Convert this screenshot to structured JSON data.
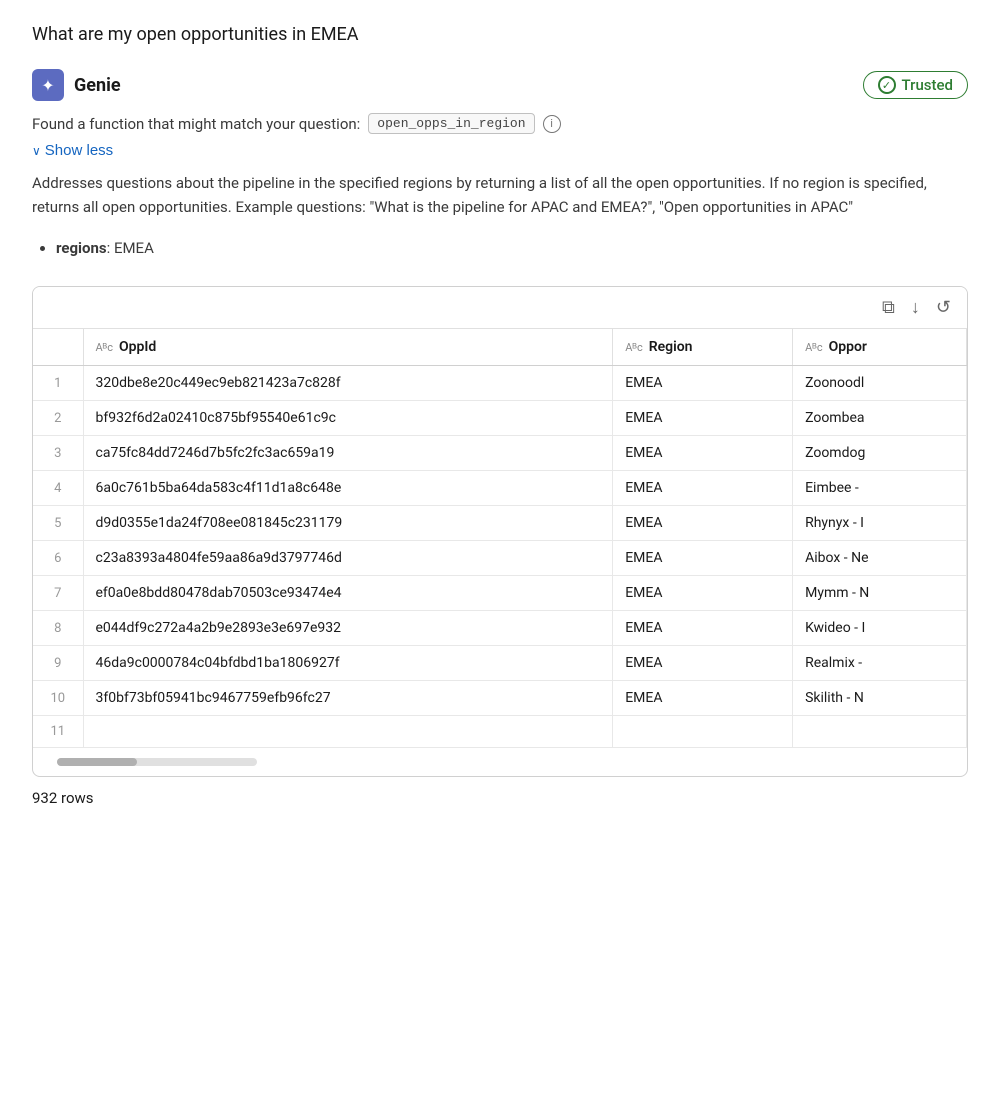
{
  "query": {
    "text": "What are my open opportunities in EMEA"
  },
  "genie": {
    "name": "Genie",
    "icon_symbol": "✦",
    "trusted_label": "Trusted",
    "found_function_text": "Found a function that might match your question:",
    "function_name": "open_opps_in_region",
    "show_less_label": "Show less",
    "description": "Addresses questions about the pipeline in the specified regions by returning a list of all the open opportunities. If no region is specified, returns all open opportunities. Example questions: \"What is the pipeline for APAC and EMEA?\", \"Open opportunities in APAC\"",
    "param_label": "regions",
    "param_value": "EMEA"
  },
  "toolbar": {
    "copy_icon": "⧉",
    "download_icon": "↓",
    "refresh_icon": "↺"
  },
  "table": {
    "columns": [
      {
        "id": "row_num",
        "label": "",
        "type": ""
      },
      {
        "id": "oppid",
        "label": "OppId",
        "type": "Aᴮc"
      },
      {
        "id": "region",
        "label": "Region",
        "type": "Aᴮc"
      },
      {
        "id": "opportu",
        "label": "Oppor",
        "type": "Aᴮc"
      }
    ],
    "rows": [
      {
        "num": "1",
        "oppid": "320dbe8e20c449ec9eb821423a7c828f",
        "region": "EMEA",
        "opportu": "Zoonoodl"
      },
      {
        "num": "2",
        "oppid": "bf932f6d2a02410c875bf95540e61c9c",
        "region": "EMEA",
        "opportu": "Zoombea"
      },
      {
        "num": "3",
        "oppid": "ca75fc84dd7246d7b5fc2fc3ac659a19",
        "region": "EMEA",
        "opportu": "Zoomdog"
      },
      {
        "num": "4",
        "oppid": "6a0c761b5ba64da583c4f11d1a8c648e",
        "region": "EMEA",
        "opportu": "Eimbee -"
      },
      {
        "num": "5",
        "oppid": "d9d0355e1da24f708ee081845c231179",
        "region": "EMEA",
        "opportu": "Rhynyx - I"
      },
      {
        "num": "6",
        "oppid": "c23a8393a4804fe59aa86a9d3797746d",
        "region": "EMEA",
        "opportu": "Aibox - Ne"
      },
      {
        "num": "7",
        "oppid": "ef0a0e8bdd80478dab70503ce93474e4",
        "region": "EMEA",
        "opportu": "Mymm - N"
      },
      {
        "num": "8",
        "oppid": "e044df9c272a4a2b9e2893e3e697e932",
        "region": "EMEA",
        "opportu": "Kwideo - I"
      },
      {
        "num": "9",
        "oppid": "46da9c0000784c04bfdbd1ba1806927f",
        "region": "EMEA",
        "opportu": "Realmix -"
      },
      {
        "num": "10",
        "oppid": "3f0bf73bf05941bc9467759efb96fc27",
        "region": "EMEA",
        "opportu": "Skilith - N"
      }
    ],
    "next_row_num": "11",
    "rows_count": "932 rows"
  }
}
